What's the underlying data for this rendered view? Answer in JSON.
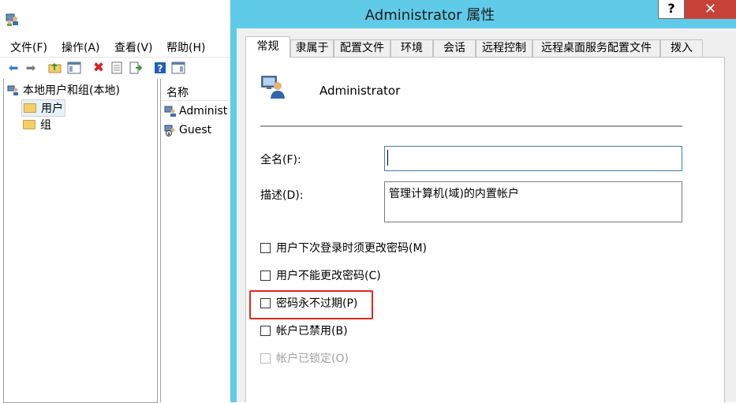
{
  "background_window": {
    "menu": [
      "文件(F)",
      "操作(A)",
      "查看(V)",
      "帮助(H)"
    ],
    "tree": {
      "root": "本地用户和组(本地)",
      "children": [
        "用户",
        "组"
      ],
      "selected": "用户"
    },
    "list": {
      "column": "名称",
      "rows": [
        "Administ",
        "Guest"
      ]
    }
  },
  "dialog": {
    "title": "Administrator 属性",
    "help_label": "?",
    "close_label": "✕",
    "tabs": [
      "常规",
      "隶属于",
      "配置文件",
      "环境",
      "会话",
      "远程控制",
      "远程桌面服务配置文件",
      "拨入"
    ],
    "active_tab": "常规",
    "user_name": "Administrator",
    "fullname_label": "全名(F):",
    "fullname_value": "",
    "description_label": "描述(D):",
    "description_value": "管理计算机(域)的内置帐户",
    "checkboxes": [
      {
        "label": "用户下次登录时须更改密码(M)",
        "checked": false,
        "disabled": false
      },
      {
        "label": "用户不能更改密码(C)",
        "checked": false,
        "disabled": false
      },
      {
        "label": "密码永不过期(P)",
        "checked": false,
        "disabled": false,
        "highlighted": true
      },
      {
        "label": "帐户已禁用(B)",
        "checked": false,
        "disabled": false
      },
      {
        "label": "帐户已锁定(O)",
        "checked": false,
        "disabled": true
      }
    ],
    "highlight_color": "#e0281f"
  },
  "colors": {
    "dialog_frame": "#5fcbe9",
    "close_button": "#c7433a"
  }
}
